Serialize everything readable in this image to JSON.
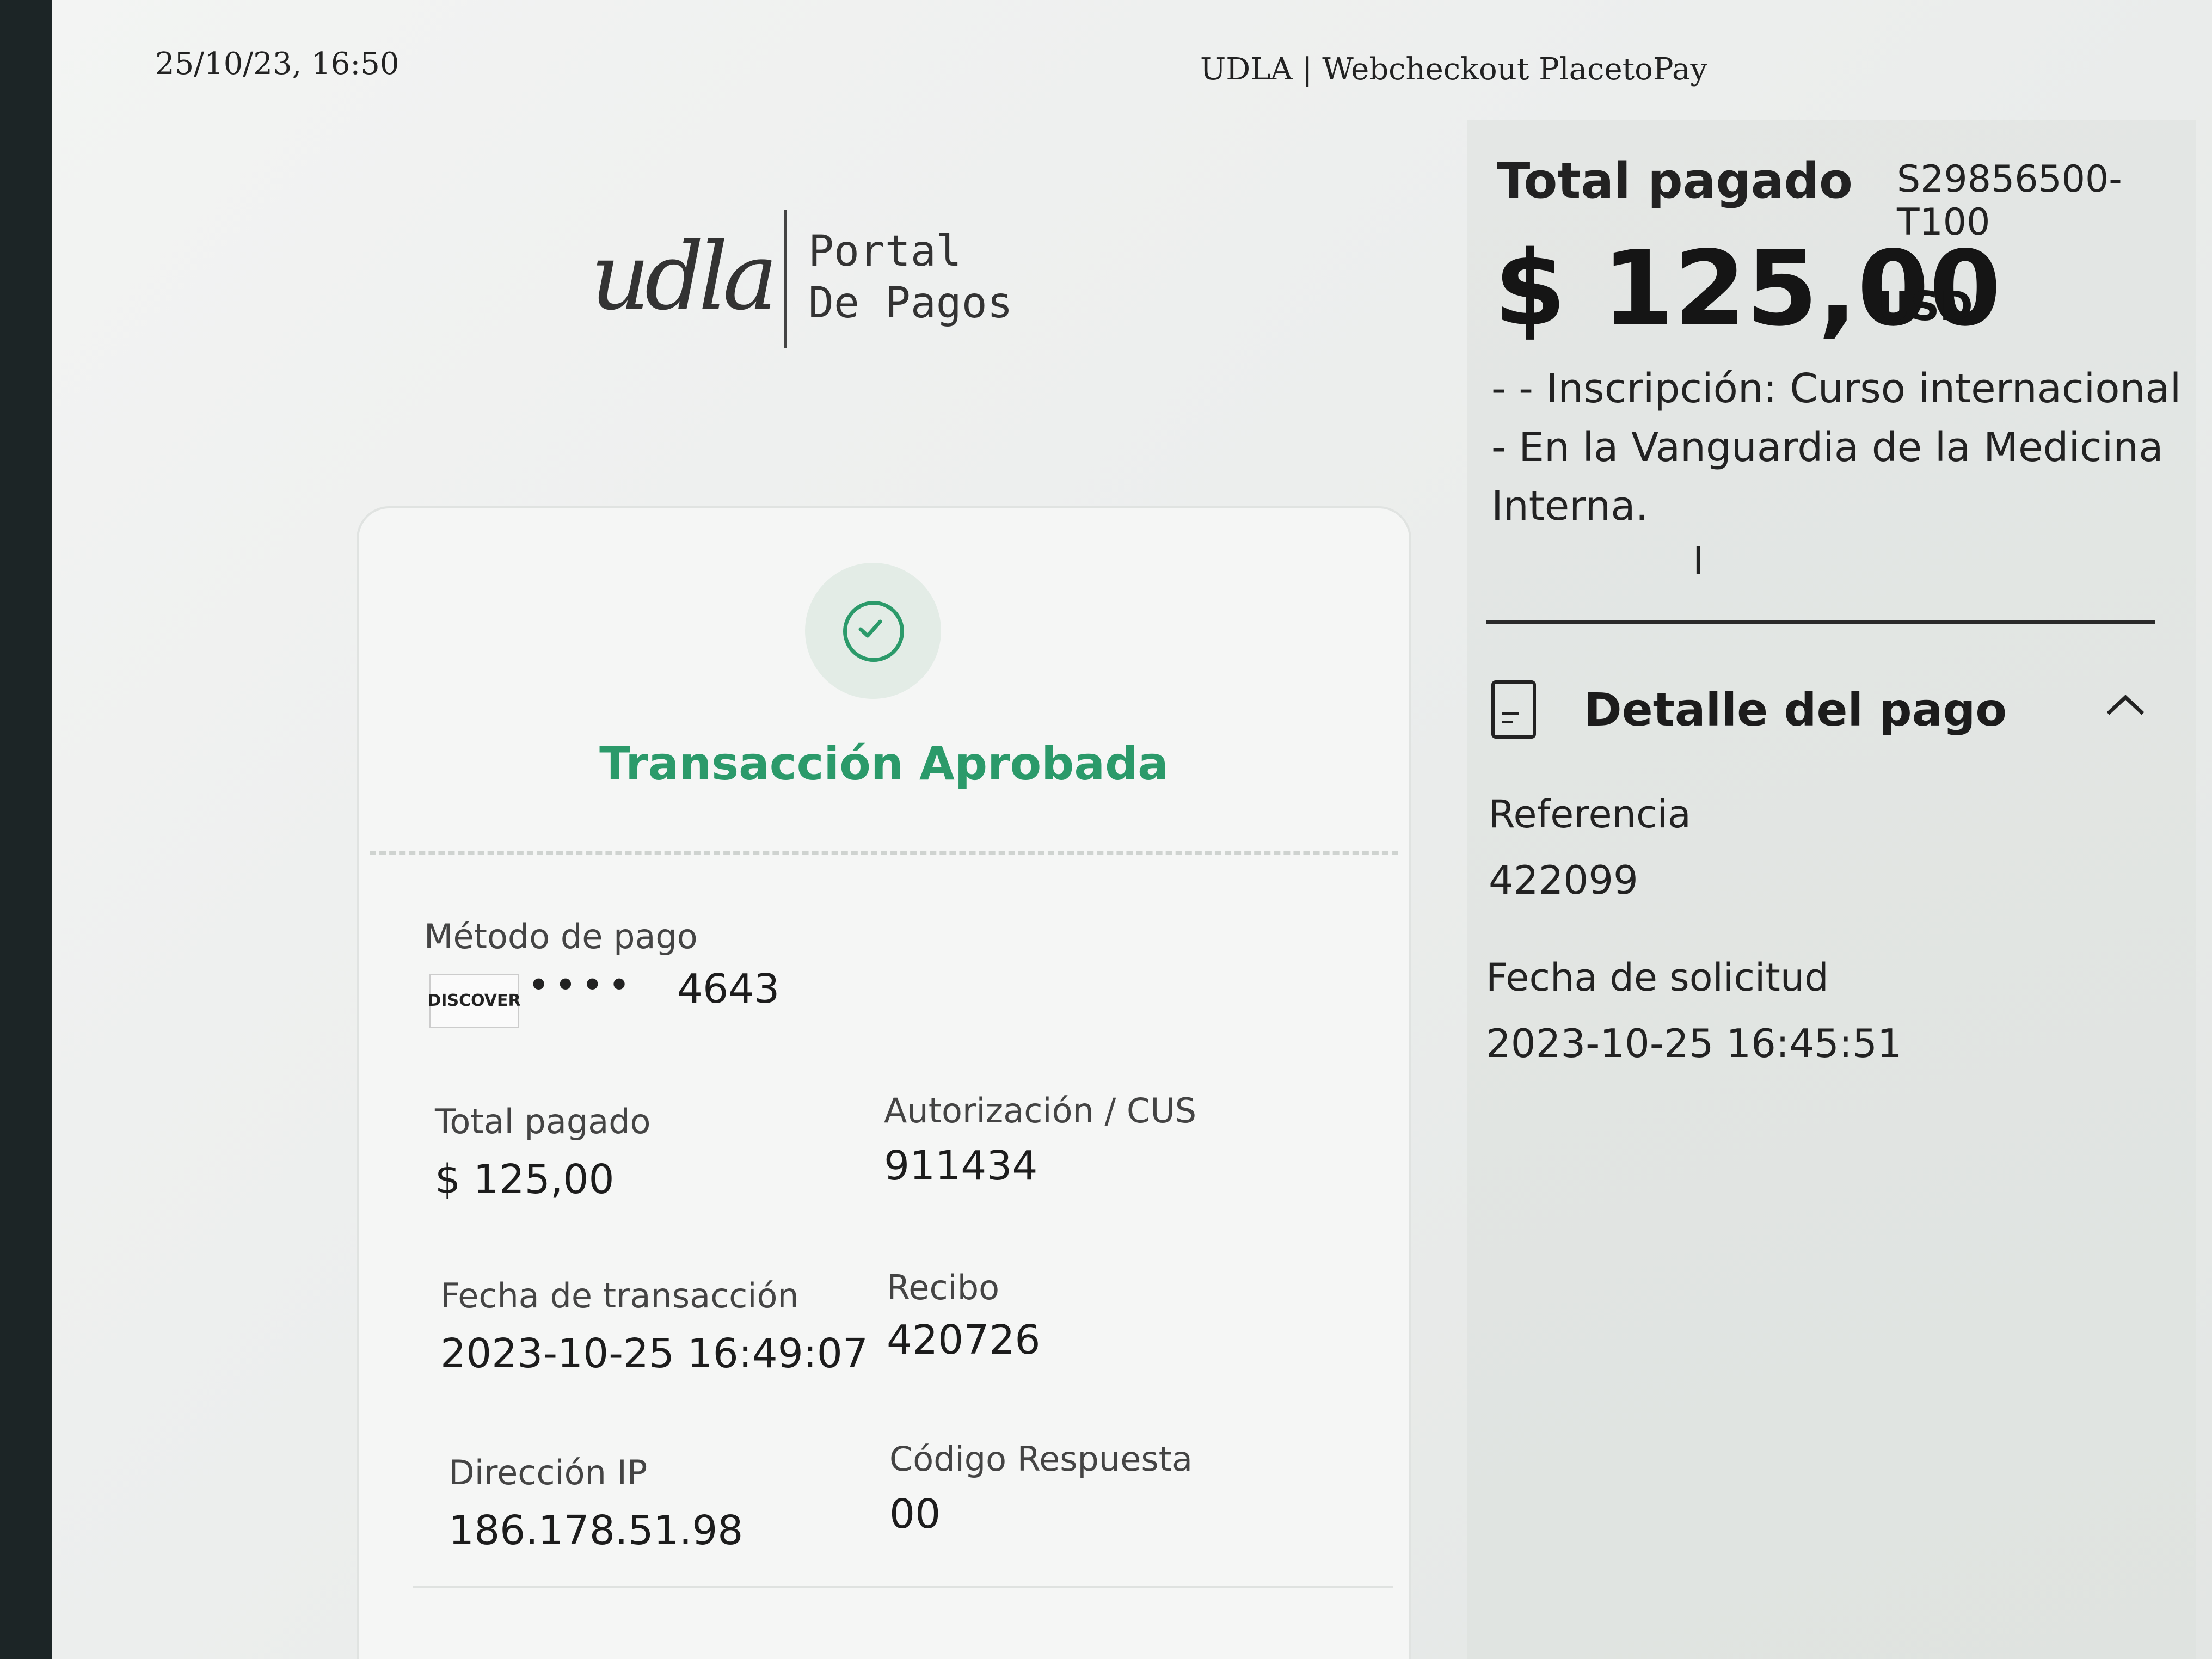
{
  "header": {
    "datetime": "25/10/23, 16:50",
    "title": "UDLA | Webcheckout PlacetoPay"
  },
  "logo": {
    "mark": "udla",
    "text": "Portal De Pagos"
  },
  "transaction": {
    "status": "Transacción Aprobada",
    "payment_method_label": "Método de pago",
    "card_brand": "DISCOVER",
    "card_masked": "••••",
    "card_last4": "4643",
    "total_label": "Total pagado",
    "total_value": "$ 125,00",
    "auth_label": "Autorización / CUS",
    "auth_value": "911434",
    "date_label": "Fecha de transacción",
    "date_value": "2023-10-25 16:49:07",
    "receipt_label": "Recibo",
    "receipt_value": "420726",
    "ip_label": "Dirección IP",
    "ip_value": "186.178.51.98",
    "code_label": "Código Respuesta",
    "code_value": "00"
  },
  "summary": {
    "total_label": "Total pagado",
    "reference_code": "S29856500-T100",
    "amount": "$ 125,00",
    "currency": "USD",
    "description": "- - Inscripción: Curso internacional - En la Vanguardia de la Medicina Interna.",
    "detail_title": "Detalle del pago",
    "reference_label": "Referencia",
    "reference_value": "422099",
    "request_date_label": "Fecha de solicitud",
    "request_date_value": "2023-10-25 16:45:51"
  },
  "icons": {
    "check": "check-circle-icon",
    "document": "document-icon",
    "chevron": "chevron-up-icon",
    "cursor": "text-cursor-icon"
  },
  "colors": {
    "success": "#2b9a6a",
    "text": "#1c1c1c"
  }
}
